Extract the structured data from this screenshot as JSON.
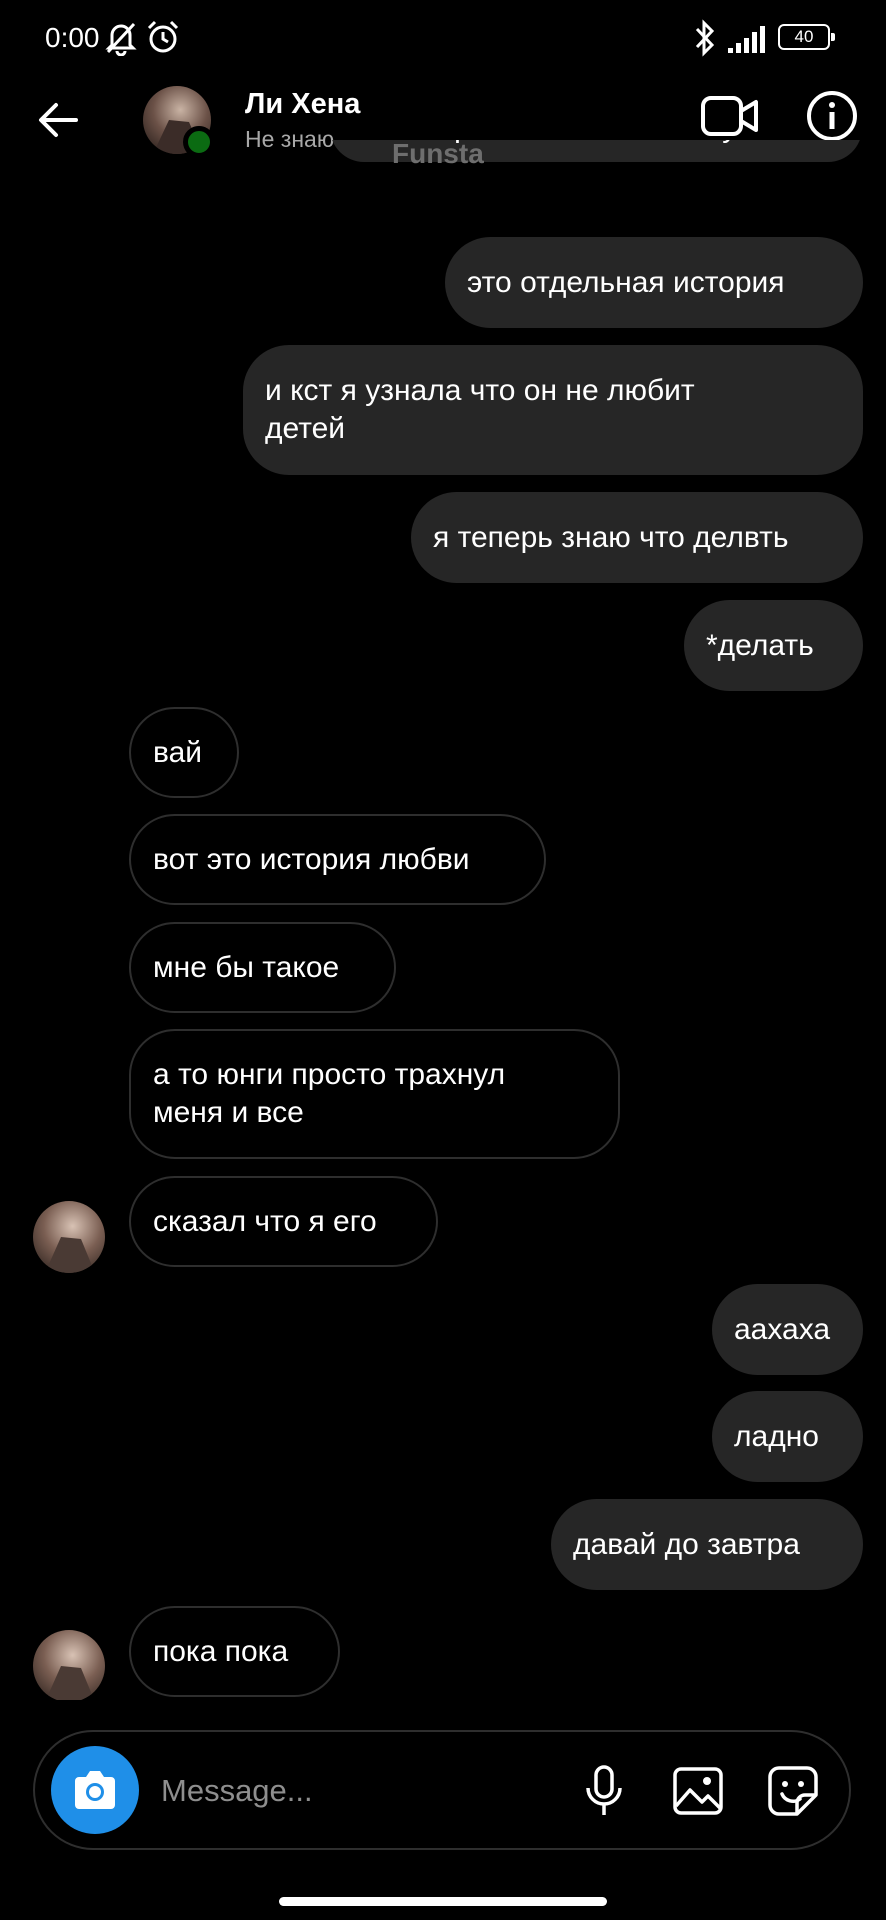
{
  "status_bar": {
    "time": "0:00",
    "battery": "40"
  },
  "header": {
    "contact_name": "Ли Хена",
    "contact_status": "Не знаю",
    "watermark": "Funsta"
  },
  "messages": [
    {
      "dir": "out",
      "text": "мы просто в малышом гуляли"
    },
    {
      "dir": "out",
      "text": "это отдельная история"
    },
    {
      "dir": "out",
      "text": "и кст я узнала что он не любит\nдетей"
    },
    {
      "dir": "out",
      "text": "я теперь знаю что делвть"
    },
    {
      "dir": "out",
      "text": "*делать"
    },
    {
      "dir": "in",
      "text": "вай"
    },
    {
      "dir": "in",
      "text": "вот это история любви"
    },
    {
      "dir": "in",
      "text": "мне бы такое"
    },
    {
      "dir": "in",
      "text": "а то юнги просто трахнул\nменя и все"
    },
    {
      "dir": "in",
      "text": "сказал что я его",
      "avatar": true
    },
    {
      "dir": "out",
      "text": "аахаха"
    },
    {
      "dir": "out",
      "text": "ладно"
    },
    {
      "dir": "out",
      "text": "давай до завтра"
    },
    {
      "dir": "in",
      "text": "пока пока",
      "avatar": true
    }
  ],
  "composer": {
    "placeholder": "Message..."
  },
  "colors": {
    "accent": "#1f8fe8",
    "outgoing_bubble": "#262626",
    "online": "#0b6b12"
  }
}
